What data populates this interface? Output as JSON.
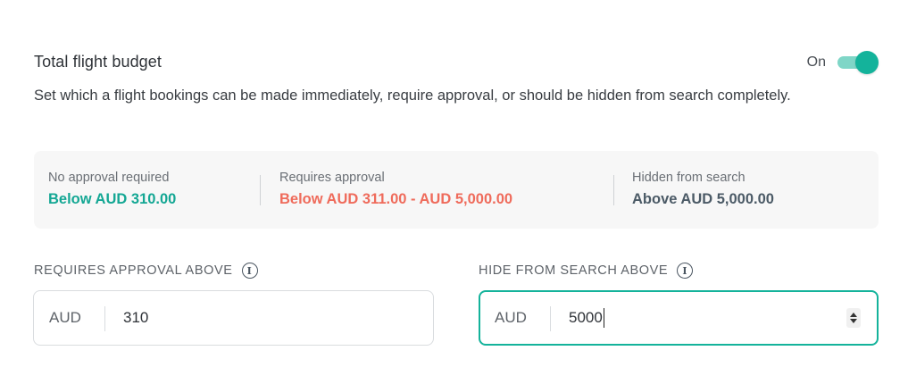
{
  "header": {
    "title": "Total flight budget",
    "toggle_label": "On",
    "toggle_state": "on",
    "description": "Set which a flight bookings can be made immediately, require approval, or should be hidden from search completely."
  },
  "summary": {
    "no_approval": {
      "label": "No approval required",
      "value": "Below AUD 310.00",
      "color": "#14a794"
    },
    "requires_approval": {
      "label": "Requires approval",
      "value": "Below AUD 311.00 - AUD 5,000.00",
      "color": "#ef6b5b"
    },
    "hidden": {
      "label": "Hidden from search",
      "value": "Above AUD 5,000.00",
      "color": "#4b5a66"
    }
  },
  "fields": {
    "approval_above": {
      "label": "REQUIRES APPROVAL ABOVE",
      "currency": "AUD",
      "value": "310"
    },
    "hide_above": {
      "label": "HIDE FROM SEARCH ABOVE",
      "currency": "AUD",
      "value": "5000"
    }
  },
  "colors": {
    "accent": "#14b39b"
  }
}
